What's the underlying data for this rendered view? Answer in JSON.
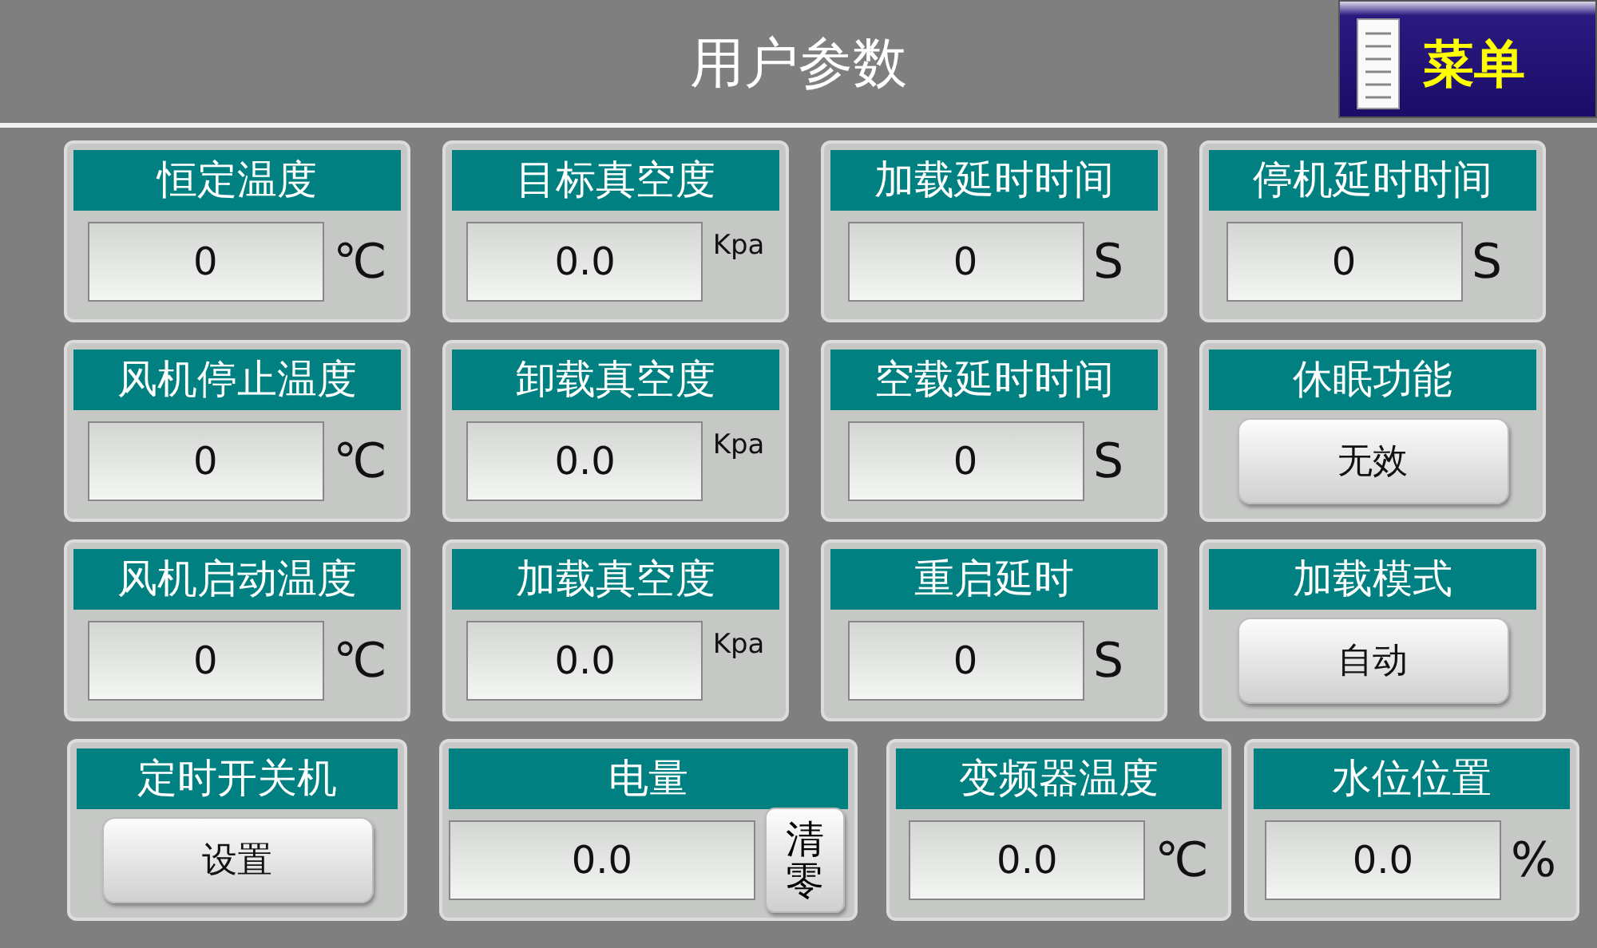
{
  "header": {
    "title": "用户参数",
    "menu_button": "菜单"
  },
  "cards": [
    {
      "kind": "field",
      "title": "恒定温度",
      "value": "0",
      "unit": "℃"
    },
    {
      "kind": "field",
      "title": "目标真空度",
      "value": "0.0",
      "unit": "Kpa"
    },
    {
      "kind": "field",
      "title": "加载延时时间",
      "value": "0",
      "unit": "S"
    },
    {
      "kind": "field",
      "title": "停机延时时间",
      "value": "0",
      "unit": "S"
    },
    {
      "kind": "field",
      "title": "风机停止温度",
      "value": "0",
      "unit": "℃"
    },
    {
      "kind": "field",
      "title": "卸载真空度",
      "value": "0.0",
      "unit": "Kpa"
    },
    {
      "kind": "field",
      "title": "空载延时时间",
      "value": "0",
      "unit": "S"
    },
    {
      "kind": "button",
      "title": "休眠功能",
      "button": "无效"
    },
    {
      "kind": "field",
      "title": "风机启动温度",
      "value": "0",
      "unit": "℃"
    },
    {
      "kind": "field",
      "title": "加载真空度",
      "value": "0.0",
      "unit": "Kpa"
    },
    {
      "kind": "field",
      "title": "重启延时",
      "value": "0",
      "unit": "S"
    },
    {
      "kind": "button",
      "title": "加载模式",
      "button": "自动"
    },
    {
      "kind": "button",
      "title": "定时开关机",
      "button": "设置"
    },
    {
      "kind": "field_button",
      "title": "电量",
      "value": "0.0",
      "button": "清零"
    },
    {
      "kind": "field",
      "title": "变频器温度",
      "value": "0.0",
      "unit": "℃"
    },
    {
      "kind": "field",
      "title": "水位位置",
      "value": "0.0",
      "unit": "%"
    }
  ]
}
